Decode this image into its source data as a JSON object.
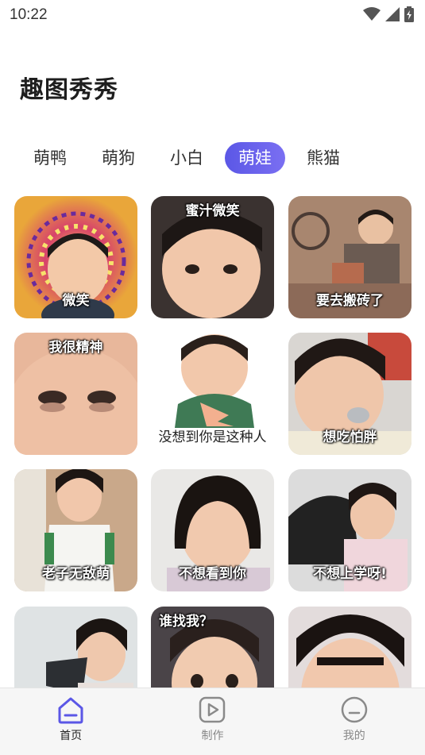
{
  "status_bar": {
    "time": "10:22"
  },
  "page_title": "趣图秀秀",
  "tabs": [
    {
      "label": "萌鸭",
      "active": false
    },
    {
      "label": "萌狗",
      "active": false
    },
    {
      "label": "小白",
      "active": false
    },
    {
      "label": "萌娃",
      "active": true
    },
    {
      "label": "熊猫",
      "active": false
    }
  ],
  "cards": [
    {
      "caption": "微笑"
    },
    {
      "caption": "蜜汁微笑"
    },
    {
      "caption": "要去搬砖了"
    },
    {
      "caption": "我很精神"
    },
    {
      "caption": "没想到你是这种人"
    },
    {
      "caption": "想吃怕胖"
    },
    {
      "caption": "老子无敌萌"
    },
    {
      "caption": "不想看到你"
    },
    {
      "caption": "不想上学呀!"
    },
    {
      "caption": ""
    },
    {
      "caption": "谁找我？"
    },
    {
      "caption": ""
    }
  ],
  "bottom_nav": [
    {
      "label": "首页",
      "icon": "home-icon",
      "active": true
    },
    {
      "label": "制作",
      "icon": "play-icon",
      "active": false
    },
    {
      "label": "我的",
      "icon": "profile-face-icon",
      "active": false
    }
  ],
  "colors": {
    "accent": "#5b57e6",
    "active_nav_icon": "#5b57e6",
    "inactive_nav_icon": "#8a8a8a"
  }
}
